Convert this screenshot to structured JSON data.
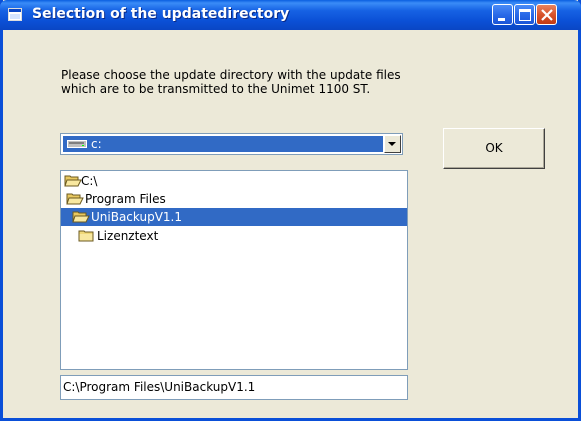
{
  "window": {
    "title": "Selection of the updatedirectory",
    "controls": {
      "minimize": "minimize",
      "maximize": "maximize",
      "close": "close"
    }
  },
  "instructions": {
    "line1": "Please choose the update directory with the update files",
    "line2": "which are to be transmitted to the Unimet 1100 ST."
  },
  "drive_select": {
    "value": "c:",
    "icon": "drive-icon"
  },
  "ok_button": {
    "label": "OK"
  },
  "directory_tree": {
    "items": [
      {
        "label": "C:\\",
        "icon": "open-folder-icon",
        "selected": false
      },
      {
        "label": "Program Files",
        "icon": "open-folder-icon",
        "selected": false
      },
      {
        "label": "UniBackupV1.1",
        "icon": "open-folder-icon",
        "selected": true
      },
      {
        "label": "Lizenztext",
        "icon": "folder-icon",
        "selected": false
      }
    ]
  },
  "path_field": {
    "value": "C:\\Program Files\\UniBackupV1.1"
  },
  "colors": {
    "titlebar": "#0a5ee0",
    "selection": "#316ac5",
    "dialog_bg": "#ece9d8",
    "close_button": "#d8542c"
  }
}
